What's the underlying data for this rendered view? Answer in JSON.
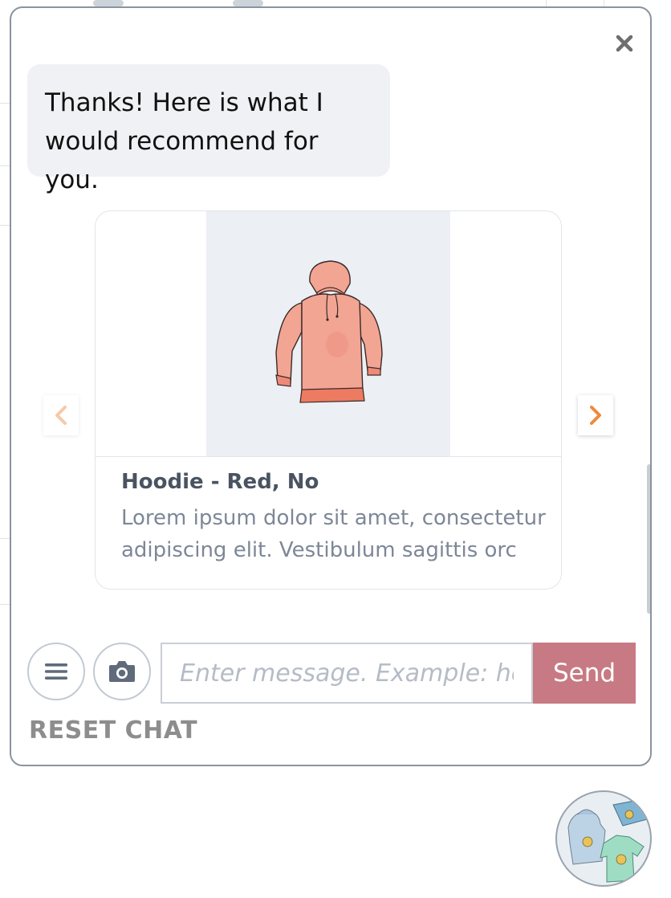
{
  "chat": {
    "bot_message": "Thanks! Here is what I would recommend for you.",
    "close_symbol": "×"
  },
  "product": {
    "title": "Hoodie - Red, No",
    "description": "Lorem ipsum dolor sit amet, consectetur adipiscing elit. Vestibulum sagittis orc"
  },
  "carousel": {
    "prev_icon": "chevron-left-icon",
    "next_icon": "chevron-right-icon"
  },
  "composer": {
    "placeholder": "Enter message. Example: hello",
    "send_label": "Send",
    "menu_icon": "hamburger-menu-icon",
    "camera_icon": "camera-icon"
  },
  "footer": {
    "reset_label": "RESET CHAT"
  },
  "colors": {
    "send_button": "#c77a83",
    "chevron": "#ee8a3c",
    "bubble_bg": "#eff1f4",
    "hoodie": "#f09a88"
  }
}
